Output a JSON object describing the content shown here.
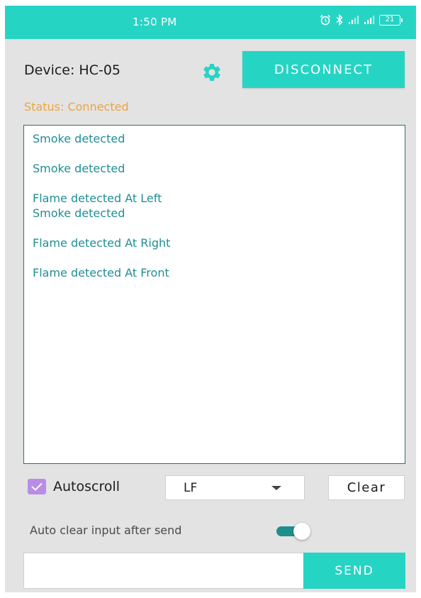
{
  "status_bar": {
    "time": "1:50 PM",
    "battery": "21",
    "icons": [
      "alarm-icon",
      "bluetooth-icon",
      "signal-icon",
      "signal-icon",
      "battery-icon"
    ]
  },
  "header": {
    "device_label": "Device: HC-05",
    "settings_icon": "gear-icon",
    "disconnect_label": "DISCONNECT"
  },
  "status": {
    "text": "Status: Connected"
  },
  "log": {
    "entries": [
      "Smoke detected",
      "Smoke detected",
      "Flame detected At Left\nSmoke detected",
      "Flame detected At Right",
      "Flame detected At Front"
    ]
  },
  "controls": {
    "autoscroll_label": "Autoscroll",
    "autoscroll_checked": true,
    "line_ending_selected": "LF",
    "clear_label": "Clear",
    "auto_clear_label": "Auto clear input after send",
    "auto_clear_on": true
  },
  "send": {
    "input_value": "",
    "placeholder": "",
    "send_label": "SEND"
  },
  "colors": {
    "accent": "#26d4c4",
    "status_text": "#f0a43a",
    "log_text": "#1f8e95",
    "log_border": "#2a6f76",
    "checkbox": "#b98ce8",
    "toggle_track": "#1d8f8a",
    "background": "#e3e3e3"
  }
}
